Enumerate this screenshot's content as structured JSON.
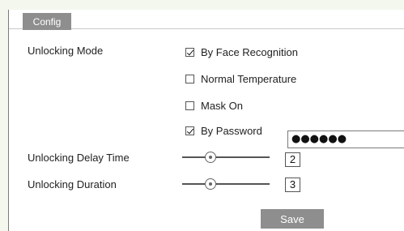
{
  "tab": {
    "label": "Config"
  },
  "unlocking_mode": {
    "label": "Unlocking Mode",
    "options": [
      {
        "label": "By Face Recognition",
        "checked": true
      },
      {
        "label": "Normal Temperature",
        "checked": false
      },
      {
        "label": "Mask On",
        "checked": false
      },
      {
        "label": "By Password",
        "checked": true
      }
    ],
    "password_value": "●●●●●●"
  },
  "delay_time": {
    "label": "Unlocking Delay Time",
    "value": "2"
  },
  "duration": {
    "label": "Unlocking Duration",
    "value": "3"
  },
  "save_label": "Save"
}
